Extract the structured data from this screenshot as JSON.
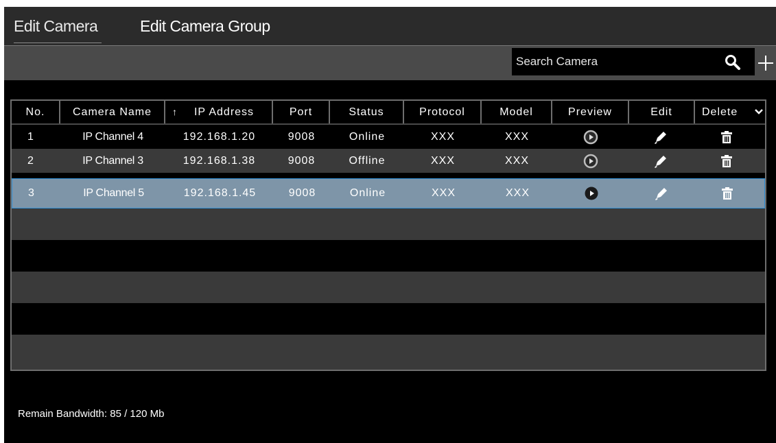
{
  "tabs": [
    {
      "label": "Edit Camera",
      "active": true
    },
    {
      "label": "Edit Camera Group",
      "active": false
    }
  ],
  "search": {
    "placeholder": "Search Camera",
    "value": ""
  },
  "table": {
    "columns": [
      "No.",
      "Camera Name",
      "IP Address",
      "Port",
      "Status",
      "Protocol",
      "Model",
      "Preview",
      "Edit",
      "Delete"
    ],
    "sort_indicator": "↑",
    "rows": [
      {
        "no": "1",
        "name": "IP Channel 4",
        "ip": "192.168.1.20",
        "port": "9008",
        "status": "Online",
        "protocol": "XXX",
        "model": "XXX"
      },
      {
        "no": "2",
        "name": "IP Channel 3",
        "ip": "192.168.1.38",
        "port": "9008",
        "status": "Offline",
        "protocol": "XXX",
        "model": "XXX"
      },
      {
        "no": "3",
        "name": "IP Channel 5",
        "ip": "192.168.1.45",
        "port": "9008",
        "status": "Online",
        "protocol": "XXX",
        "model": "XXX",
        "selected": true
      }
    ]
  },
  "footer": {
    "bandwidth": "Remain Bandwidth: 85 / 120 Mb"
  },
  "colors": {
    "panel": "#000000",
    "toolbar": "#4a4a4a",
    "selected_row": "#7e95a8",
    "selected_border": "#2e8fd6"
  },
  "icons": {
    "search": "search-icon",
    "add": "plus-icon",
    "preview": "play-icon",
    "edit": "pencil-icon",
    "delete": "trash-icon",
    "column_menu": "chevron-down-icon"
  }
}
